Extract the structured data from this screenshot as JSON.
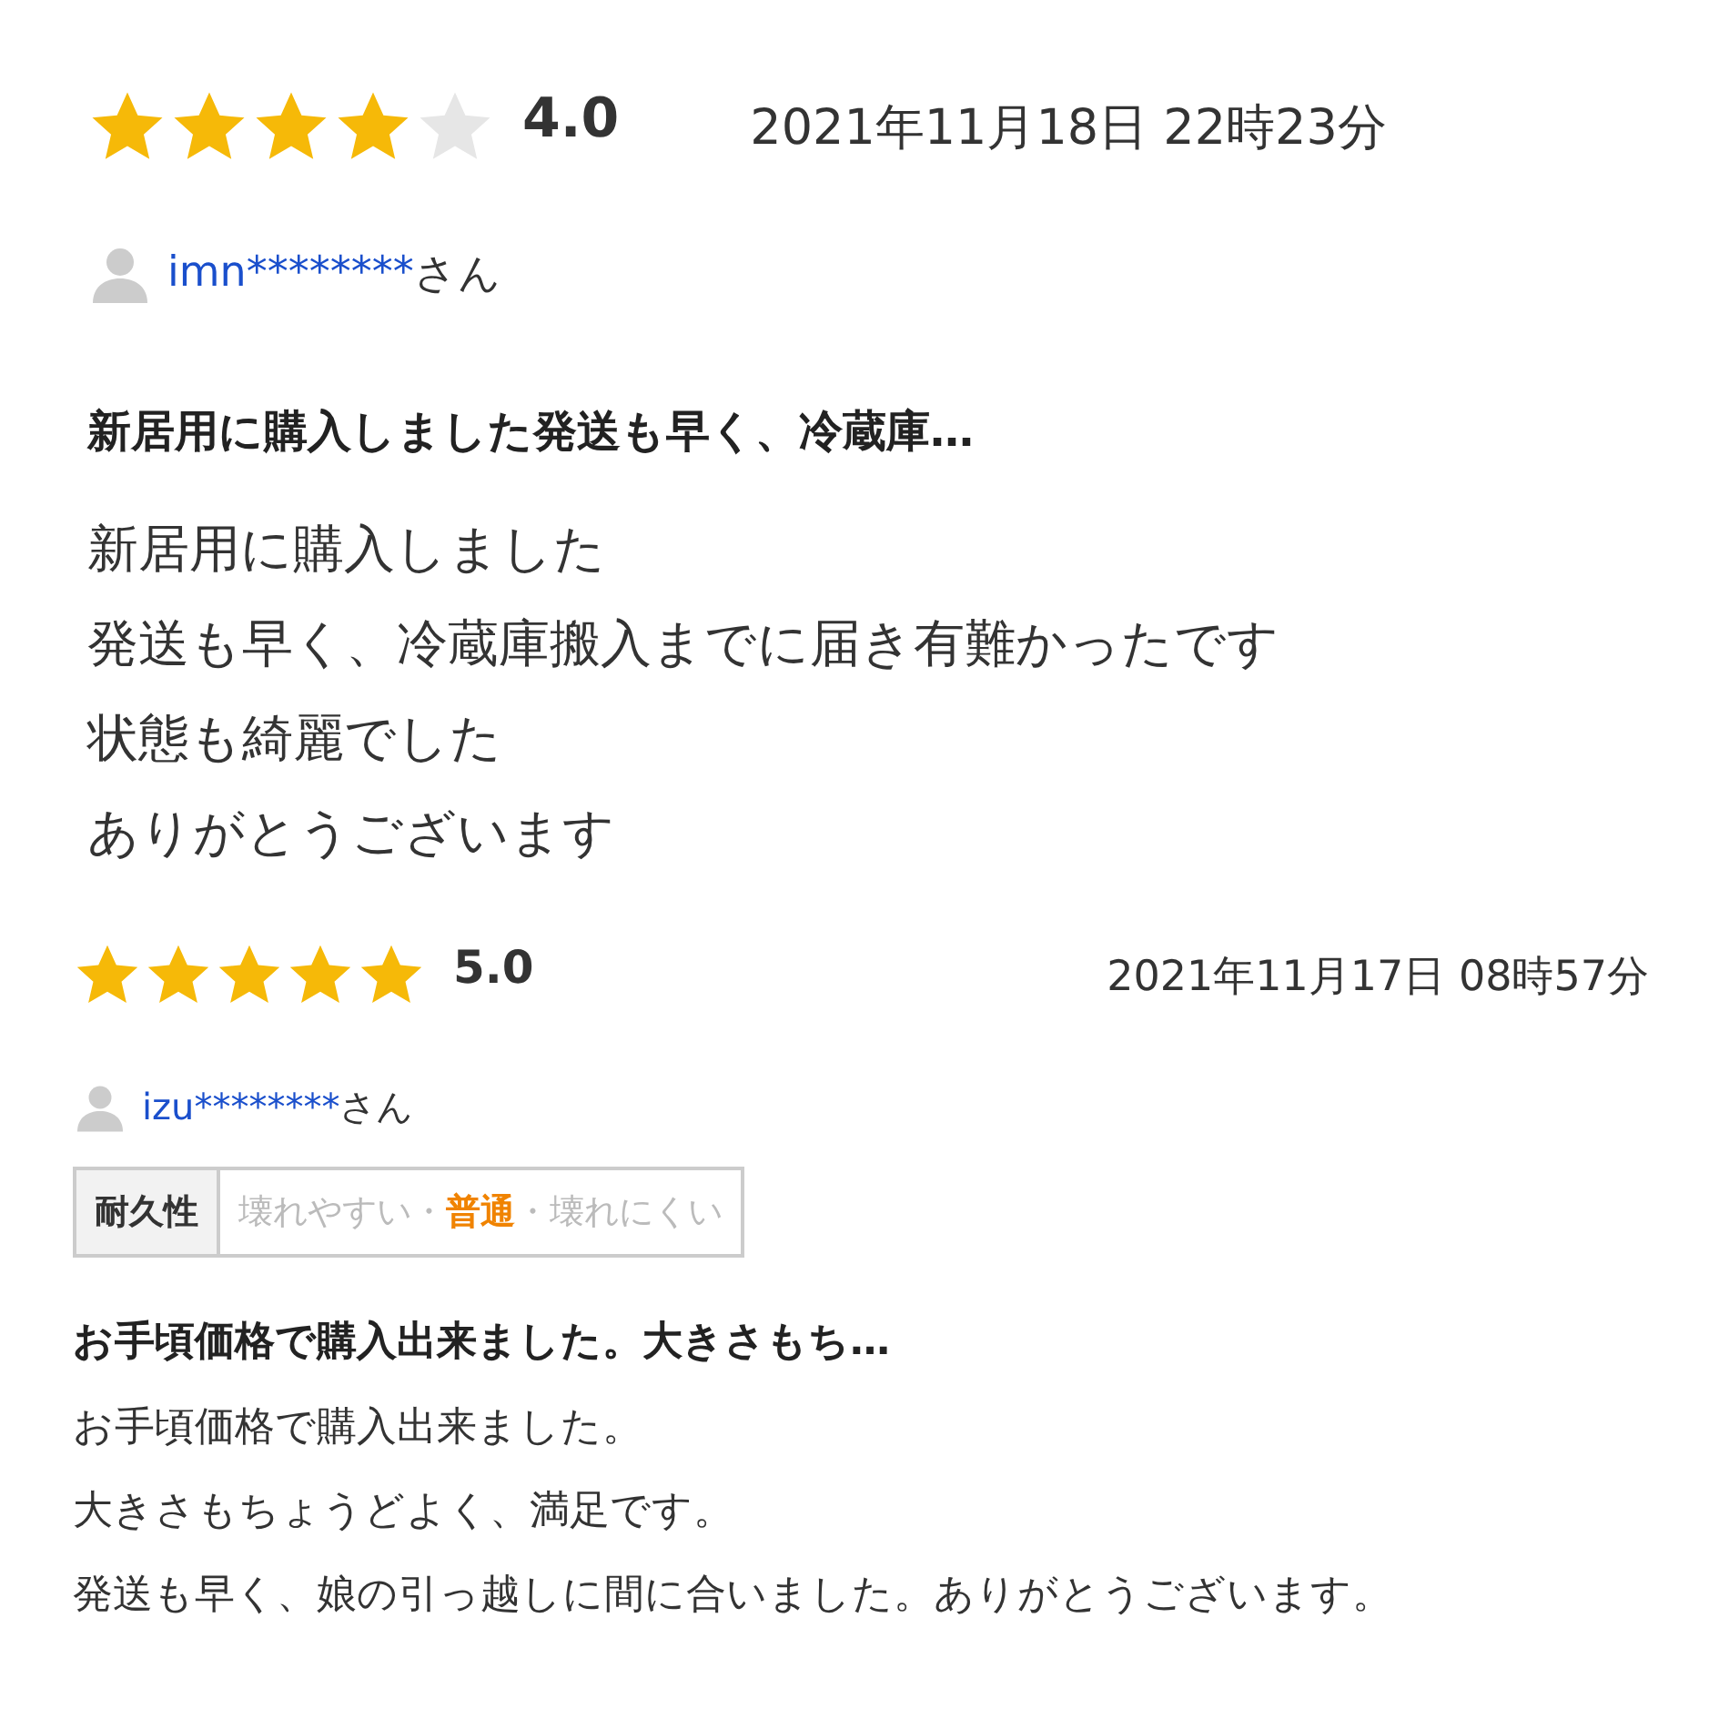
{
  "reviews": [
    {
      "stars": 4,
      "rating": "4.0",
      "date": "2021年11月18日 22時23分",
      "user": "imn********",
      "honorific": "さん",
      "title": "新居用に購入しました発送も早く、冷蔵庫…",
      "body": [
        "新居用に購入しました",
        "発送も早く、冷蔵庫搬入までに届き有難かったです",
        "状態も綺麗でした",
        "ありがとうございます"
      ]
    },
    {
      "stars": 5,
      "rating": "5.0",
      "date": "2021年11月17日 08時57分",
      "user": "izu********",
      "honorific": "さん",
      "attributes": [
        {
          "label": "耐久性",
          "separator": "・",
          "options": [
            {
              "text": "壊れやすい",
              "selected": false
            },
            {
              "text": "普通",
              "selected": true
            },
            {
              "text": "壊れにくい",
              "selected": false
            }
          ]
        }
      ],
      "title": "お手頃価格で購入出来ました。大きさもち…",
      "body": [
        "お手頃価格で購入出来ました。",
        "大きさもちょうどよく、満足です。",
        "発送も早く、娘の引っ越しに間に合いました。ありがとうございます。"
      ]
    }
  ]
}
